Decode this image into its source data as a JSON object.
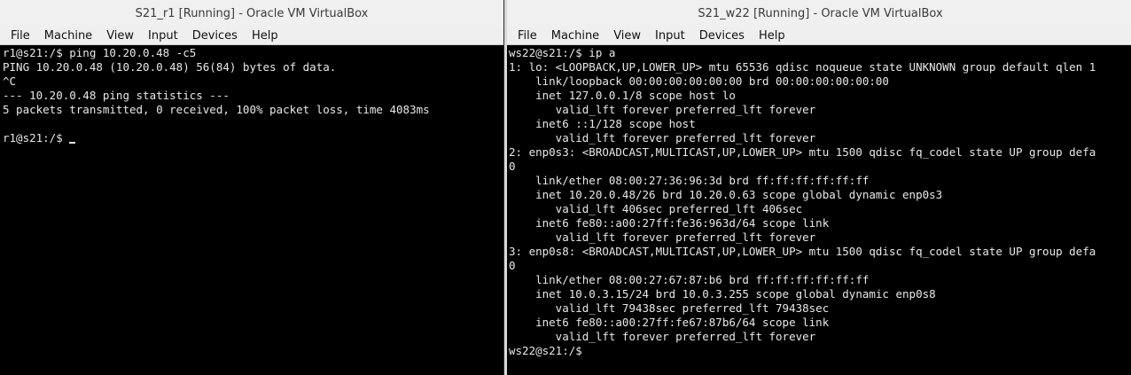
{
  "left": {
    "title": "S21_r1 [Running] - Oracle VM VirtualBox",
    "menu": [
      "File",
      "Machine",
      "View",
      "Input",
      "Devices",
      "Help"
    ],
    "lines": [
      "r1@s21:/$ ping 10.20.0.48 -c5",
      "PING 10.20.0.48 (10.20.0.48) 56(84) bytes of data.",
      "^C",
      "--- 10.20.0.48 ping statistics ---",
      "5 packets transmitted, 0 received, 100% packet loss, time 4083ms",
      "",
      "r1@s21:/$ "
    ]
  },
  "right": {
    "title": "S21_w22 [Running] - Oracle VM VirtualBox",
    "menu": [
      "File",
      "Machine",
      "View",
      "Input",
      "Devices",
      "Help"
    ],
    "lines": [
      "ws22@s21:/$ ip a",
      "1: lo: <LOOPBACK,UP,LOWER_UP> mtu 65536 qdisc noqueue state UNKNOWN group default qlen 1",
      "    link/loopback 00:00:00:00:00:00 brd 00:00:00:00:00:00",
      "    inet 127.0.0.1/8 scope host lo",
      "       valid_lft forever preferred_lft forever",
      "    inet6 ::1/128 scope host",
      "       valid_lft forever preferred_lft forever",
      "2: enp0s3: <BROADCAST,MULTICAST,UP,LOWER_UP> mtu 1500 qdisc fq_codel state UP group defa",
      "0",
      "    link/ether 08:00:27:36:96:3d brd ff:ff:ff:ff:ff:ff",
      "    inet 10.20.0.48/26 brd 10.20.0.63 scope global dynamic enp0s3",
      "       valid_lft 406sec preferred_lft 406sec",
      "    inet6 fe80::a00:27ff:fe36:963d/64 scope link",
      "       valid_lft forever preferred_lft forever",
      "3: enp0s8: <BROADCAST,MULTICAST,UP,LOWER_UP> mtu 1500 qdisc fq_codel state UP group defa",
      "0",
      "    link/ether 08:00:27:67:87:b6 brd ff:ff:ff:ff:ff:ff",
      "    inet 10.0.3.15/24 brd 10.0.3.255 scope global dynamic enp0s8",
      "       valid_lft 79438sec preferred_lft 79438sec",
      "    inet6 fe80::a00:27ff:fe67:87b6/64 scope link",
      "       valid_lft forever preferred_lft forever",
      "ws22@s21:/$ "
    ]
  }
}
